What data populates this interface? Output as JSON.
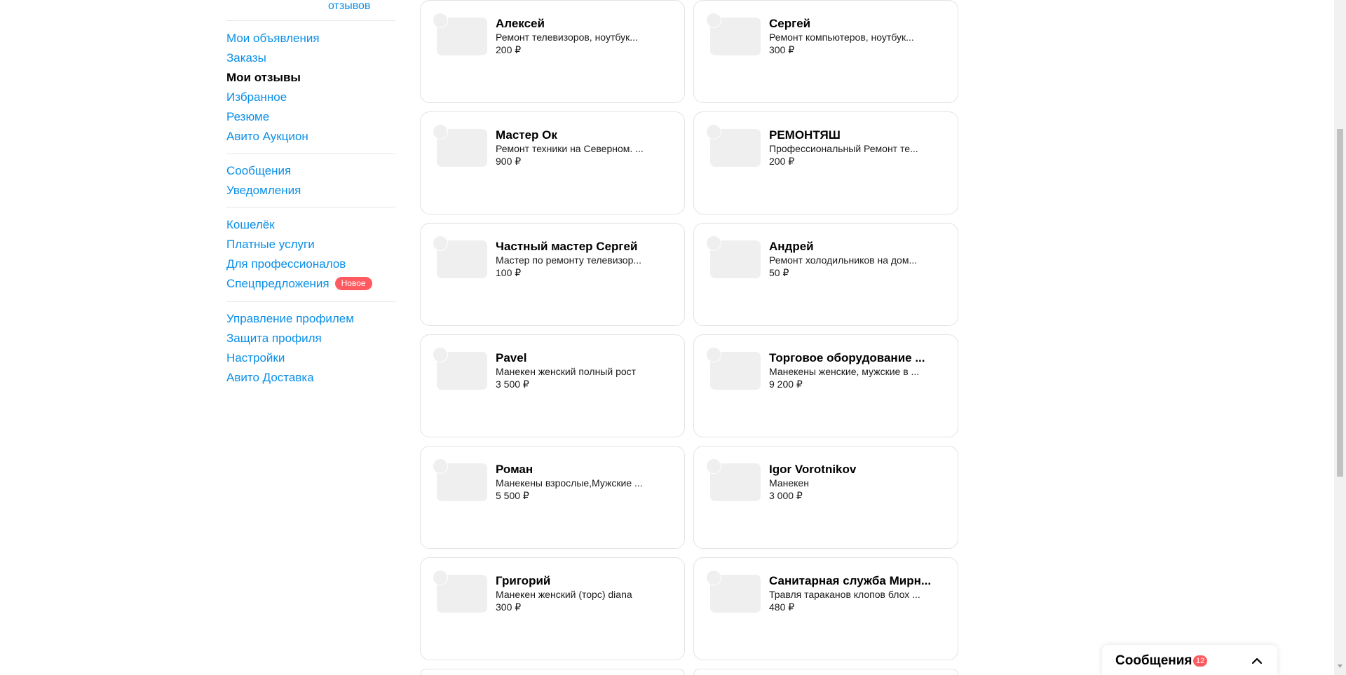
{
  "sidebar": {
    "reviews_link": "отзывов",
    "groups": [
      [
        "Мои объявления",
        "Заказы",
        "Мои отзывы",
        "Избранное",
        "Резюме",
        "Авито Аукцион"
      ],
      [
        "Сообщения",
        "Уведомления"
      ],
      [
        "Кошелёк",
        "Платные услуги",
        "Для профессионалов",
        "Спецпредложения"
      ],
      [
        "Управление профилем",
        "Защита профиля",
        "Настройки",
        "Авито Доставка"
      ]
    ],
    "active_item": "Мои отзывы",
    "new_badge": "Новое"
  },
  "cards": [
    {
      "name": "Алексей",
      "desc": "Ремонт телевизоров, ноутбук...",
      "price": "200 ₽"
    },
    {
      "name": "Сергей",
      "desc": "Ремонт компьютеров, ноутбук...",
      "price": "300 ₽"
    },
    {
      "name": "Мастер Ок",
      "desc": "Ремонт техники на Северном. ...",
      "price": "900 ₽"
    },
    {
      "name": "РЕМОНТЯШ",
      "desc": "Профессиональный Ремонт те...",
      "price": "200 ₽"
    },
    {
      "name": "Частный мастер Сергей",
      "desc": "Мастер по ремонту телевизор...",
      "price": "100 ₽"
    },
    {
      "name": "Андрей",
      "desc": "Ремонт холодильников на дом...",
      "price": "50 ₽"
    },
    {
      "name": "Pavel",
      "desc": "Манекен женский полный рост",
      "price": "3 500 ₽"
    },
    {
      "name": "Торговое оборудование ...",
      "desc": "Манекены женские, мужские в ...",
      "price": "9 200 ₽"
    },
    {
      "name": "Роман",
      "desc": "Манекены взрослые,Мужские ...",
      "price": "5 500 ₽"
    },
    {
      "name": "Igor Vorotnikov",
      "desc": "Манекен",
      "price": "3 000 ₽"
    },
    {
      "name": "Григорий",
      "desc": "Манекен женский (торс) diana",
      "price": "300 ₽"
    },
    {
      "name": "Санитарная служба Мирн...",
      "desc": "Травля тараканов клопов блох ...",
      "price": "480 ₽"
    }
  ],
  "messenger": {
    "title": "Сообщения",
    "unread_count": "12",
    "chevron": "chevron-up-icon"
  },
  "colors": {
    "link": "#0a8fe8",
    "badge": "#ff5a5f",
    "card_border": "#e3e3e3",
    "placeholder": "#efefef"
  }
}
